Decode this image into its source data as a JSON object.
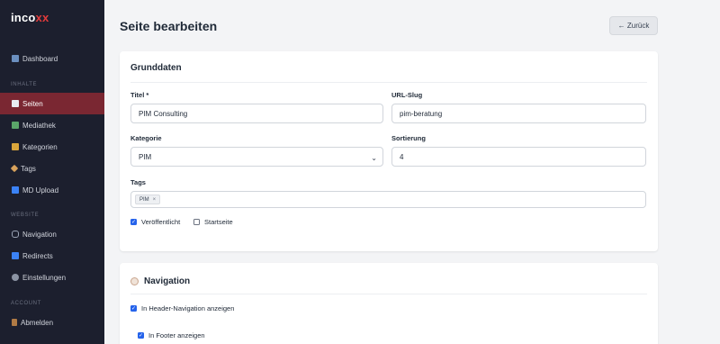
{
  "sidebar": {
    "logo_main": "inco",
    "logo_accent": "xx",
    "sections": {
      "content": "INHALTE",
      "website": "WEBSITE",
      "account": "ACCOUNT"
    },
    "items": {
      "dashboard": "Dashboard",
      "seiten": "Seiten",
      "mediathek": "Mediathek",
      "kategorien": "Kategorien",
      "tags": "Tags",
      "md_upload": "MD Upload",
      "navigation": "Navigation",
      "redirects": "Redirects",
      "einstellungen": "Einstellungen",
      "abmelden": "Abmelden"
    },
    "active": "seiten"
  },
  "header": {
    "title": "Seite bearbeiten",
    "back_label": "← Zurück"
  },
  "grunddaten": {
    "title": "Grunddaten",
    "titel_label": "Titel *",
    "titel_value": "PIM Consulting",
    "slug_label": "URL-Slug",
    "slug_value": "pim-beratung",
    "kategorie_label": "Kategorie",
    "kategorie_value": "PIM",
    "sortierung_label": "Sortierung",
    "sortierung_value": "4",
    "tags_label": "Tags",
    "tags": [
      "PIM"
    ],
    "tag_remove": "×",
    "veroeffentlicht_label": "Veröffentlicht",
    "veroeffentlicht_checked": true,
    "startseite_label": "Startseite",
    "startseite_checked": false
  },
  "navigation": {
    "title": "Navigation",
    "header_nav_label": "In Header-Navigation anzeigen",
    "header_nav_checked": true,
    "footer_label": "In Footer anzeigen",
    "footer_checked": true
  },
  "icons": {
    "dashboard": "chart-icon",
    "seiten": "document-icon",
    "mediathek": "image-icon",
    "kategorien": "folder-icon",
    "tags": "tag-icon",
    "md_upload": "upload-icon",
    "navigation": "link-icon",
    "redirects": "redirect-icon",
    "einstellungen": "gear-icon",
    "abmelden": "door-icon",
    "navigation_card": "compass-icon"
  },
  "colors": {
    "sidebar_bg": "#1c1f2e",
    "active_bg": "#7a2732",
    "accent": "#e23b3b",
    "checkbox": "#2563eb"
  }
}
